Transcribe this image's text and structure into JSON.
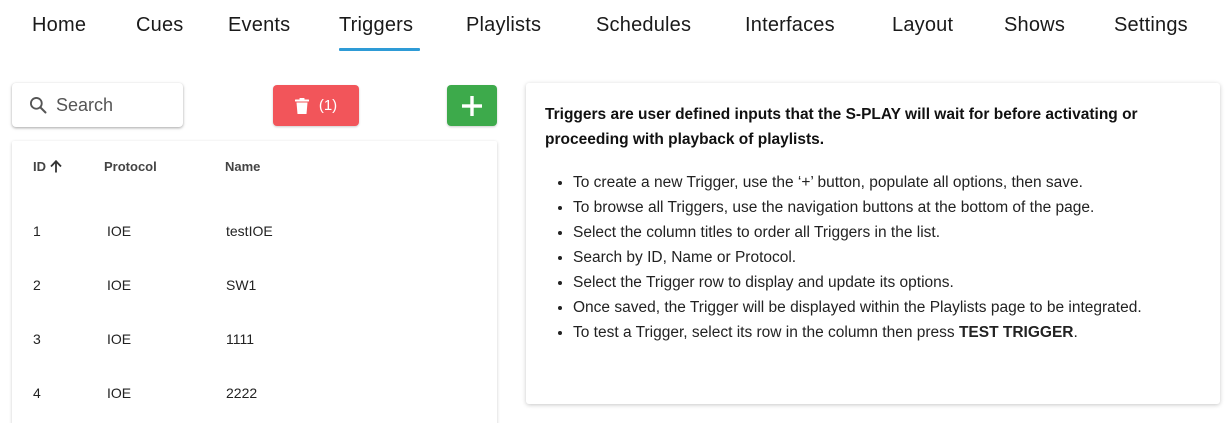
{
  "nav": {
    "items": [
      {
        "label": "Home"
      },
      {
        "label": "Cues"
      },
      {
        "label": "Events"
      },
      {
        "label": "Triggers",
        "active": true
      },
      {
        "label": "Playlists"
      },
      {
        "label": "Schedules"
      },
      {
        "label": "Interfaces"
      },
      {
        "label": "Layout"
      },
      {
        "label": "Shows"
      },
      {
        "label": "Settings"
      }
    ],
    "accent_color": "#2e9bd6"
  },
  "toolbar": {
    "search_placeholder": "Search",
    "delete_label": "(1)",
    "delete_color": "#f2555a",
    "add_color": "#3daa4b",
    "icons": [
      "search-icon",
      "trash-icon",
      "plus-icon"
    ]
  },
  "table": {
    "columns": [
      "ID",
      "Protocol",
      "Name"
    ],
    "sort_icon": "arrow-up-icon",
    "rows": [
      {
        "id": "1",
        "protocol": "IOE",
        "name": "testIOE"
      },
      {
        "id": "2",
        "protocol": "IOE",
        "name": "SW1"
      },
      {
        "id": "3",
        "protocol": "IOE",
        "name": "1111"
      },
      {
        "id": "4",
        "protocol": "IOE",
        "name": "2222"
      }
    ]
  },
  "info": {
    "heading": "Triggers are user defined inputs that the S-PLAY will wait for before activating or proceeding with playback of playlists.",
    "bullets": [
      "To create a new Trigger, use the ‘+’ button, populate all options, then save.",
      "To browse all Triggers, use the navigation buttons at the bottom of the page.",
      "Select the column titles to order all Triggers in the list.",
      "Search by ID, Name or Protocol.",
      "Select the Trigger row to display and update its options.",
      "Once saved, the Trigger will be displayed within the Playlists page to be integrated."
    ],
    "last_bullet_prefix": "To test a Trigger, select its row in the column then press ",
    "last_bullet_bold": "TEST TRIGGER",
    "last_bullet_suffix": "."
  }
}
